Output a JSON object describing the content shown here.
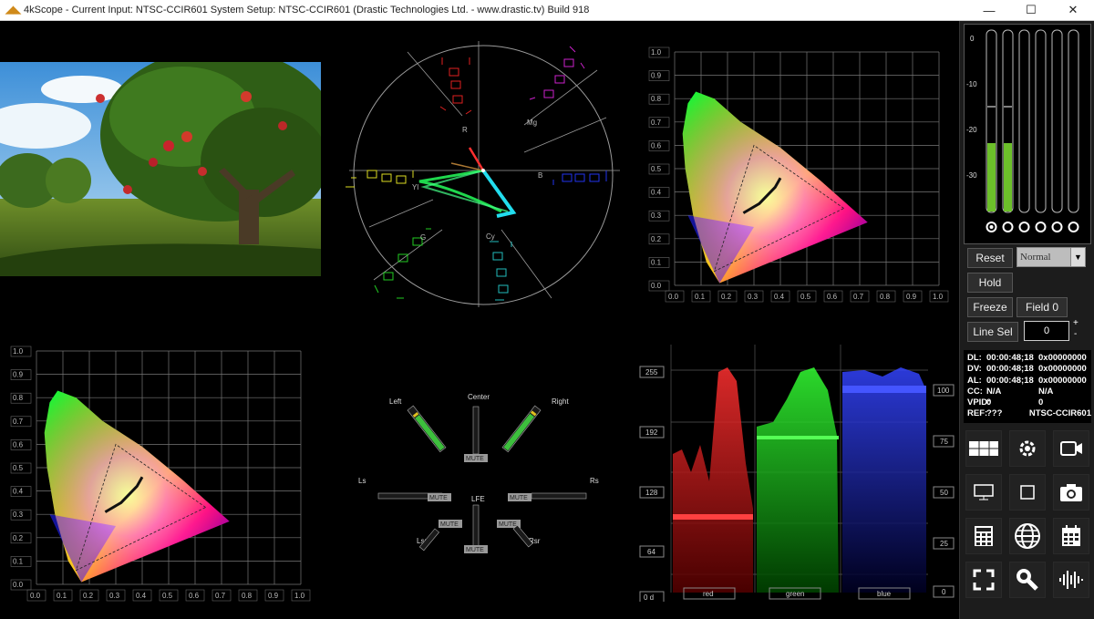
{
  "window": {
    "title": "4kScope -  Current Input: NTSC-CCIR601  System Setup: NTSC-CCIR601   (Drastic Technologies Ltd. - www.drastic.tv) Build 918",
    "minimize": "—",
    "maximize": "☐",
    "close": "✕"
  },
  "vectorscope": {
    "targets": [
      "R",
      "Mg",
      "B",
      "Cy",
      "G",
      "Yl"
    ]
  },
  "cie_ticks_y": [
    "1.0",
    "0.9",
    "0.8",
    "0.7",
    "0.6",
    "0.5",
    "0.4",
    "0.3",
    "0.2",
    "0.1",
    "0.0"
  ],
  "cie_ticks_x": [
    "0.0",
    "0.1",
    "0.2",
    "0.3",
    "0.4",
    "0.5",
    "0.6",
    "0.7",
    "0.8",
    "0.9",
    "1.0"
  ],
  "audio": {
    "channels": [
      "Left",
      "Center",
      "Right",
      "Ls",
      "Rs",
      "LFE",
      "Lsr",
      "Rsr"
    ],
    "mute_label": "MUTE"
  },
  "parade": {
    "y_left": [
      "255",
      "192",
      "128",
      "64",
      "0 d"
    ],
    "y_right": [
      "100",
      "75",
      "50",
      "25",
      "0"
    ],
    "labels": [
      "red",
      "green",
      "blue"
    ]
  },
  "meters": {
    "scale": [
      "0",
      "-10",
      "-20",
      "-30"
    ]
  },
  "panel": {
    "reset": "Reset",
    "mode_select": "Normal",
    "hold": "Hold",
    "freeze": "Freeze",
    "field": "Field 0",
    "line_sel": "Line Sel",
    "line_value": "0",
    "plus": "+",
    "minus": "-"
  },
  "timecode": [
    {
      "label": "DL:",
      "tc": "00:00:48;18",
      "val": "0x00000000"
    },
    {
      "label": "DV:",
      "tc": "00:00:48;18",
      "val": "0x00000000"
    },
    {
      "label": "AL:",
      "tc": "00:00:48;18",
      "val": "0x00000000"
    },
    {
      "label": "CC:",
      "tc": "N/A",
      "val": "N/A"
    },
    {
      "label": "VPID:",
      "tc": "0",
      "val": "0"
    },
    {
      "label": "REF:",
      "tc": "???",
      "val": "NTSC-CCIR601"
    }
  ],
  "icons": [
    "layout-grid-icon",
    "settings-gear-icon",
    "cast-camera-icon",
    "monitor-icon",
    "square-icon",
    "camera-icon",
    "calculator-icon",
    "globe-icon",
    "calendar-icon",
    "fullscreen-icon",
    "search-key-icon",
    "audio-waveform-icon"
  ],
  "colors": {
    "panel_bg": "#1c1c1c",
    "meter_green": "#6cbf2a",
    "grid_line": "#7a7a7a"
  }
}
